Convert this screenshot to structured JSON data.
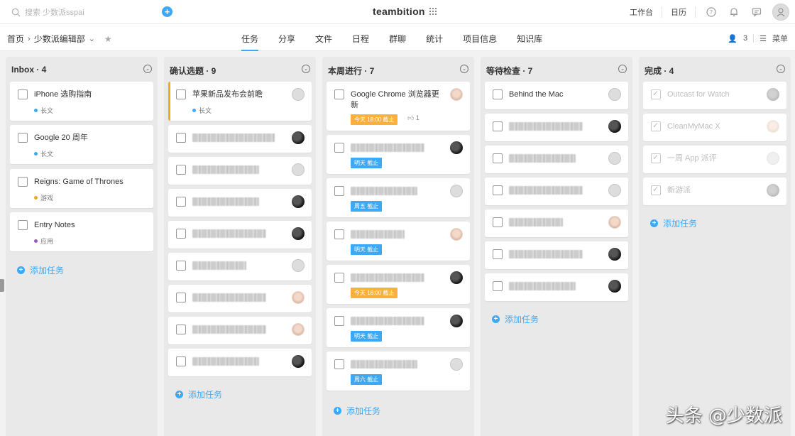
{
  "top": {
    "search_placeholder": "搜索 少数派sspai",
    "brand": "teambition",
    "links": [
      "工作台",
      "日历"
    ]
  },
  "sub": {
    "crumb_home": "首页",
    "crumb_project": "少数派编辑部",
    "tabs": [
      "任务",
      "分享",
      "文件",
      "日程",
      "群聊",
      "统计",
      "项目信息",
      "知识库"
    ],
    "member_count": "3",
    "menu_label": "菜单"
  },
  "add_task_label": "添加任务",
  "columns": [
    {
      "title": "Inbox · 4",
      "cards": [
        {
          "title": "iPhone 选购指南",
          "tag": "长文",
          "tag_color": "#3da8f5"
        },
        {
          "title": "Google 20 周年",
          "tag": "长文",
          "tag_color": "#3da8f5"
        },
        {
          "title": "Reigns: Game of Thrones",
          "tag": "游戏",
          "tag_color": "#f5a623"
        },
        {
          "title": "Entry Notes",
          "tag": "应用",
          "tag_color": "#9b59b6"
        }
      ]
    },
    {
      "title": "确认选题 · 9",
      "cards": [
        {
          "title": "苹果新品发布会前瞻",
          "tag": "长文",
          "tag_color": "#3da8f5"
        }
      ]
    },
    {
      "title": "本周进行 · 7",
      "cards": [
        {
          "title": "Google Chrome 浏览器更新",
          "badge": "今天 18:00 截止",
          "likes": "1"
        },
        {
          "badge": "明天 截止"
        },
        {
          "badge": "周五 截止"
        },
        {
          "badge": "明天 截止"
        },
        {
          "badge": "今天 18:00 截止"
        },
        {
          "badge": "明天 截止"
        },
        {
          "badge": "周六 截止"
        }
      ]
    },
    {
      "title": "等待检查 · 7",
      "cards": [
        {
          "title": "Behind the Mac"
        }
      ]
    },
    {
      "title": "完成 · 4",
      "cards": [
        {
          "title": "Outcast for Watch"
        },
        {
          "title": "CleanMyMac X"
        },
        {
          "title": "一周 App 派评"
        },
        {
          "title": "新游派"
        }
      ]
    }
  ],
  "watermark": "头条 @少数派",
  "colors": {
    "accent": "#3da8f5",
    "deadline_today": "#fbb03b",
    "deadline_other": "#3da8f5"
  }
}
